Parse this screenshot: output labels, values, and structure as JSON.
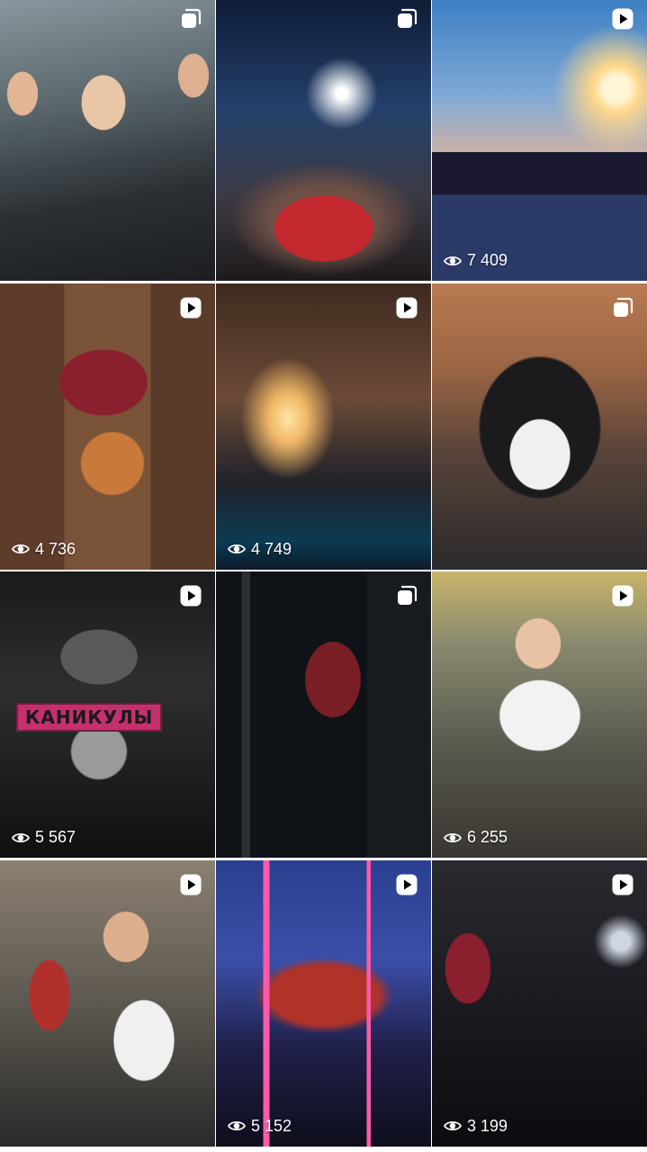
{
  "grid": {
    "tiles": [
      {
        "type": "carousel",
        "views": "",
        "banner": ""
      },
      {
        "type": "carousel",
        "views": "",
        "banner": ""
      },
      {
        "type": "reel",
        "views": "7 409",
        "banner": ""
      },
      {
        "type": "reel",
        "views": "4 736",
        "banner": ""
      },
      {
        "type": "reel",
        "views": "4 749",
        "banner": ""
      },
      {
        "type": "carousel",
        "views": "",
        "banner": ""
      },
      {
        "type": "reel",
        "views": "5 567",
        "banner": "КАНИКУЛЫ"
      },
      {
        "type": "carousel",
        "views": "",
        "banner": ""
      },
      {
        "type": "reel",
        "views": "6 255",
        "banner": ""
      },
      {
        "type": "reel",
        "views": "",
        "banner": ""
      },
      {
        "type": "reel",
        "views": "5 152",
        "banner": ""
      },
      {
        "type": "reel",
        "views": "3 199",
        "banner": ""
      }
    ]
  },
  "icons": {
    "reel": "reel-play-icon",
    "carousel": "carousel-icon",
    "views": "eye-views-icon"
  }
}
